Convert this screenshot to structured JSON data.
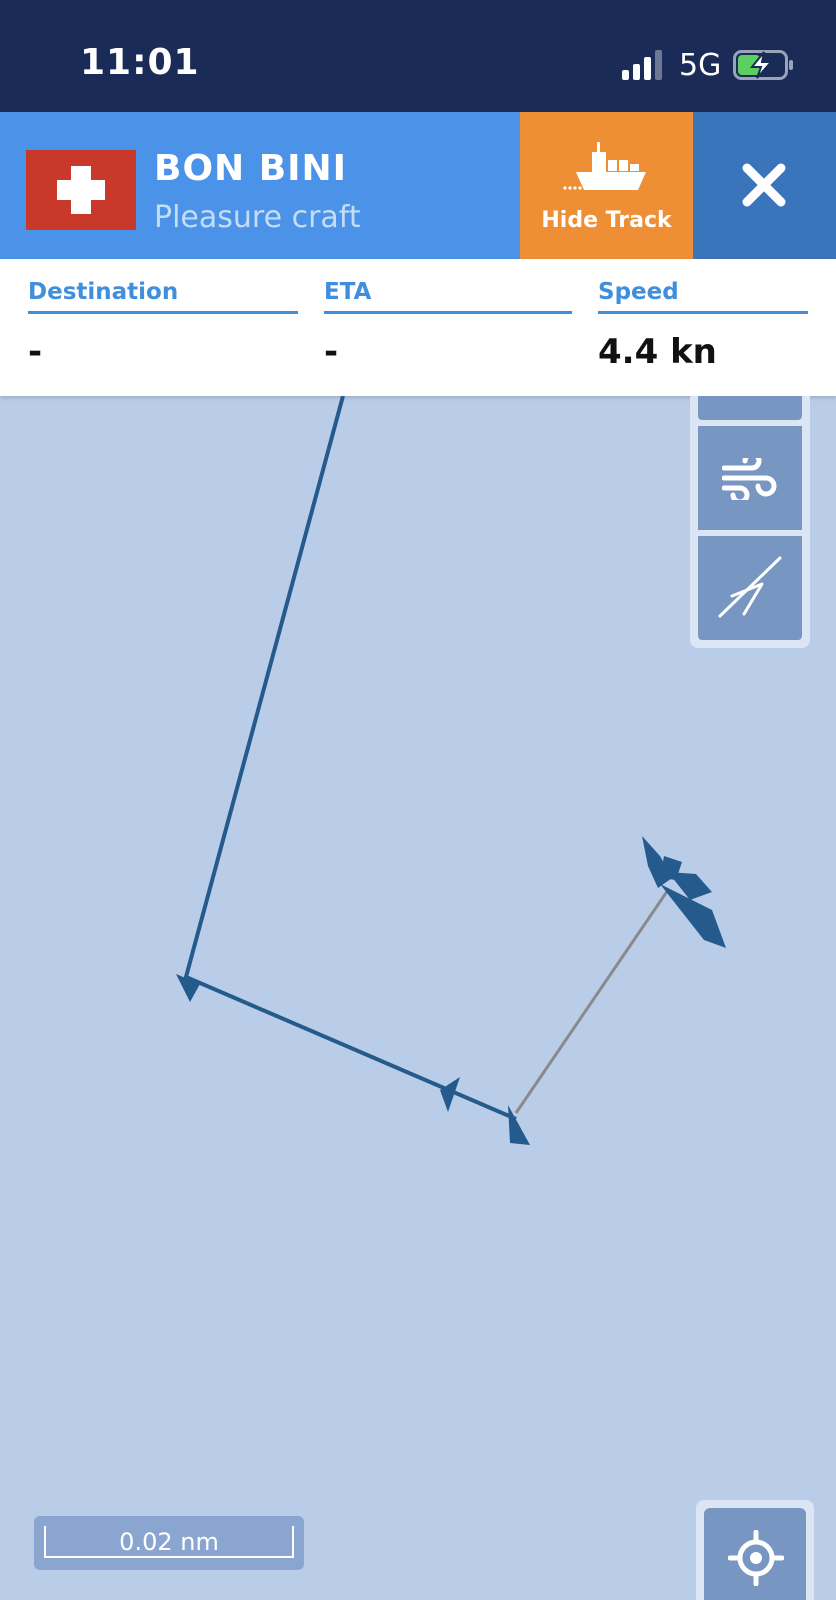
{
  "status_bar": {
    "time": "11:01",
    "network": "5G",
    "icons": [
      "signal-icon",
      "battery-charging-icon"
    ]
  },
  "vessel": {
    "flag": "flag-switzerland-icon",
    "name": "BON BINI",
    "type": "Pleasure craft",
    "hide_track_label": "Hide Track",
    "hide_track_icon": "cargo-ship-icon",
    "close_icon": "close-icon",
    "colors": {
      "header": "#4a93e8",
      "hide_track": "#ef8f35",
      "close": "#3a75bc",
      "status_bar": "#1a2b57"
    }
  },
  "info": {
    "destination_label": "Destination",
    "destination_value": "-",
    "eta_label": "ETA",
    "eta_value": "-",
    "speed_label": "Speed",
    "speed_value": "4.4 kn"
  },
  "map": {
    "background_color": "#b9cde9",
    "track_color": "#245a8c",
    "projection_color": "#8a8a8a",
    "tools": [
      "layers-icon",
      "wind-icon",
      "measure-icon"
    ],
    "locate_icon": "crosshair-icon"
  },
  "scale": {
    "label": "0.02 nm"
  }
}
